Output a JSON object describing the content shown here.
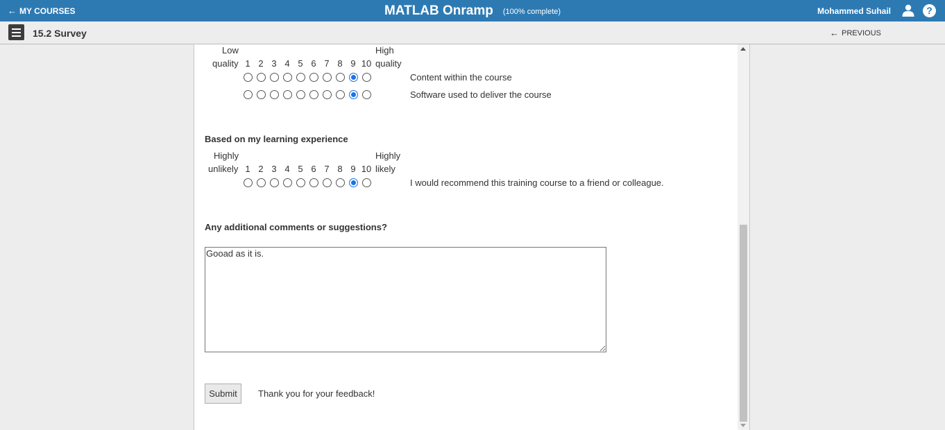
{
  "topbar": {
    "my_courses": "MY COURSES",
    "title": "MATLAB Onramp",
    "progress": "(100% complete)",
    "user_name": "Mohammed Suhail",
    "help": "?"
  },
  "subbar": {
    "section_title": "15.2 Survey",
    "previous": "PREVIOUS"
  },
  "quality_scale": {
    "low_line1": "Low",
    "low_line2": "quality",
    "high_line1": "High",
    "high_line2": "quality",
    "numbers": [
      "1",
      "2",
      "3",
      "4",
      "5",
      "6",
      "7",
      "8",
      "9",
      "10"
    ],
    "rows": [
      {
        "label": "Content within the course",
        "selected": "9"
      },
      {
        "label": "Software used to deliver the course",
        "selected": "9"
      }
    ]
  },
  "recommend": {
    "heading": "Based on my learning experience",
    "low_line1": "Highly",
    "low_line2": "unlikely",
    "high_line1": "Highly",
    "high_line2": "likely",
    "numbers": [
      "1",
      "2",
      "3",
      "4",
      "5",
      "6",
      "7",
      "8",
      "9",
      "10"
    ],
    "label": "I would recommend this training course to a friend or colleague.",
    "selected": "9"
  },
  "comments": {
    "heading": "Any additional comments or suggestions?",
    "value": "Gooad as it is."
  },
  "submit_label": "Submit",
  "thanks": "Thank you for your feedback!",
  "colors": {
    "topbar": "#2d7ab3",
    "radio_checked": "#1a73e8"
  }
}
